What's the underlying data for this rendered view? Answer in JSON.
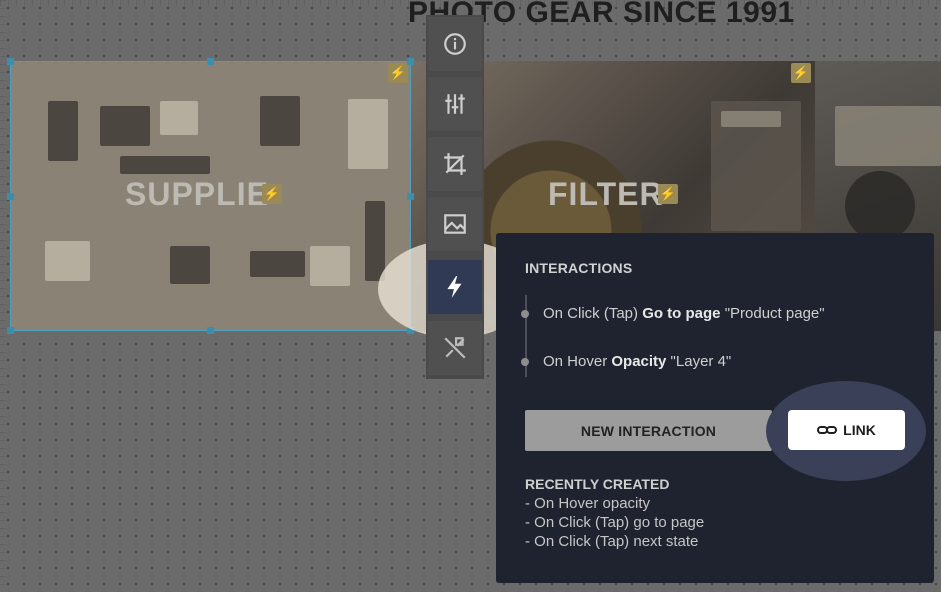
{
  "page": {
    "headline": "PHOTO GEAR SINCE 1991"
  },
  "tiles": {
    "supplies": {
      "label": "SUPPLIE"
    },
    "filters": {
      "label": "FILTER"
    }
  },
  "toolbar": {
    "tools": [
      {
        "icon": "info-icon"
      },
      {
        "icon": "sliders-icon"
      },
      {
        "icon": "crop-icon"
      },
      {
        "icon": "image-icon"
      },
      {
        "icon": "bolt-icon",
        "active": true
      },
      {
        "icon": "unlink-icon"
      }
    ]
  },
  "panel": {
    "heading": "INTERACTIONS",
    "interactions": [
      {
        "trigger": "On Click (Tap) ",
        "action": "Go to page",
        "target": " \"Product page\""
      },
      {
        "trigger": "On Hover ",
        "action": "Opacity",
        "target": " \"Layer 4\""
      }
    ],
    "new_button": "NEW INTERACTION",
    "link_button": "LINK",
    "recent_title": "RECENTLY CREATED",
    "recent_items": [
      "- On Hover opacity",
      "- On Click (Tap) go to page",
      "- On Click (Tap) next state"
    ]
  },
  "colors": {
    "panel_bg": "#1f2330",
    "active_tool": "#303a55",
    "selection": "#4da0c0"
  }
}
